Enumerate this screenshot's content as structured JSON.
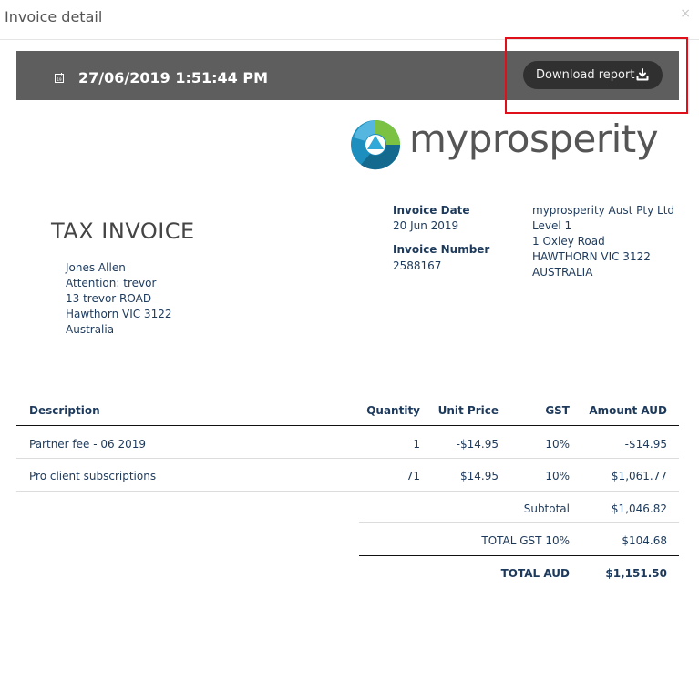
{
  "modal": {
    "title": "Invoice detail",
    "close_label": "×"
  },
  "toolbar": {
    "datetime": "27/06/2019 1:51:44 PM",
    "download_label": "Download report",
    "calendar_day": "19"
  },
  "logo": {
    "text": "myprosperity"
  },
  "invoice": {
    "heading": "TAX INVOICE",
    "customer_lines": [
      "Jones Allen",
      "Attention: trevor",
      "13 trevor ROAD",
      "Hawthorn VIC 3122",
      "Australia"
    ],
    "date_label": "Invoice Date",
    "date_value": "20 Jun 2019",
    "number_label": "Invoice Number",
    "number_value": "2588167",
    "supplier_lines": [
      "myprosperity Aust Pty Ltd",
      "Level 1",
      "1 Oxley Road",
      "HAWTHORN VIC 3122",
      "AUSTRALIA"
    ]
  },
  "table": {
    "headers": {
      "description": "Description",
      "quantity": "Quantity",
      "unit_price": "Unit Price",
      "gst": "GST",
      "amount": "Amount AUD"
    },
    "rows": [
      {
        "description": "Partner fee - 06 2019",
        "quantity": "1",
        "unit_price": "-$14.95",
        "gst": "10%",
        "amount": "-$14.95"
      },
      {
        "description": "Pro client subscriptions",
        "quantity": "71",
        "unit_price": "$14.95",
        "gst": "10%",
        "amount": "$1,061.77"
      }
    ],
    "totals": {
      "subtotal_label": "Subtotal",
      "subtotal_value": "$1,046.82",
      "gst_label": "TOTAL GST 10%",
      "gst_value": "$104.68",
      "total_label": "TOTAL AUD",
      "total_value": "$1,151.50"
    }
  }
}
